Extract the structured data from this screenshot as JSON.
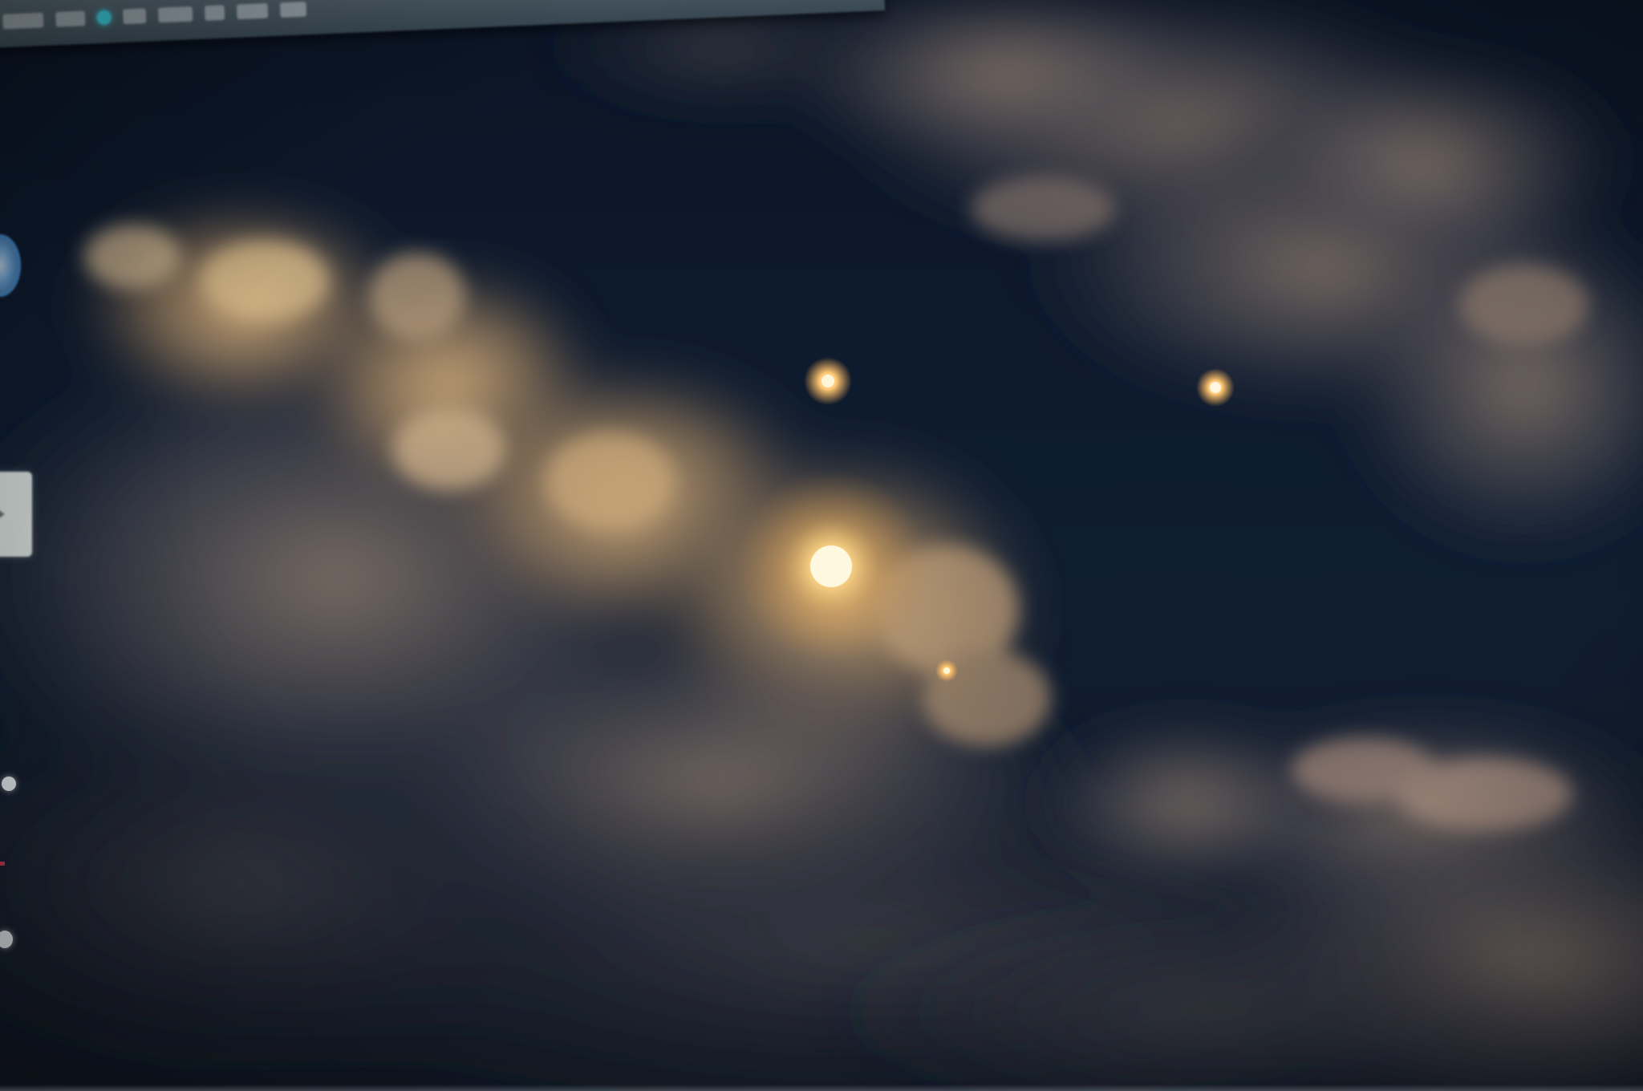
{
  "desktop": {
    "wallpaper": {
      "subject": "night-sky-clouds-moon",
      "sky_color": "#0e1a2c",
      "cloud_color": "#c9a77e",
      "glow_color": "#ffd98a"
    },
    "toolbar": {
      "accent_color": "#3cc8d8",
      "items": [
        {
          "icon": "menu-icon"
        },
        {
          "icon": "status-dot-icon"
        },
        {
          "icon": "toolbar-button-icon"
        },
        {
          "icon": "toolbar-button-icon"
        },
        {
          "icon": "toolbar-button-icon"
        },
        {
          "icon": "toolbar-button-icon"
        }
      ]
    },
    "edge_controls": [
      {
        "icon": "circle-button-icon"
      },
      {
        "icon": "play-panel-icon"
      },
      {
        "icon": "dot-icon"
      },
      {
        "icon": "dot-icon"
      }
    ]
  }
}
